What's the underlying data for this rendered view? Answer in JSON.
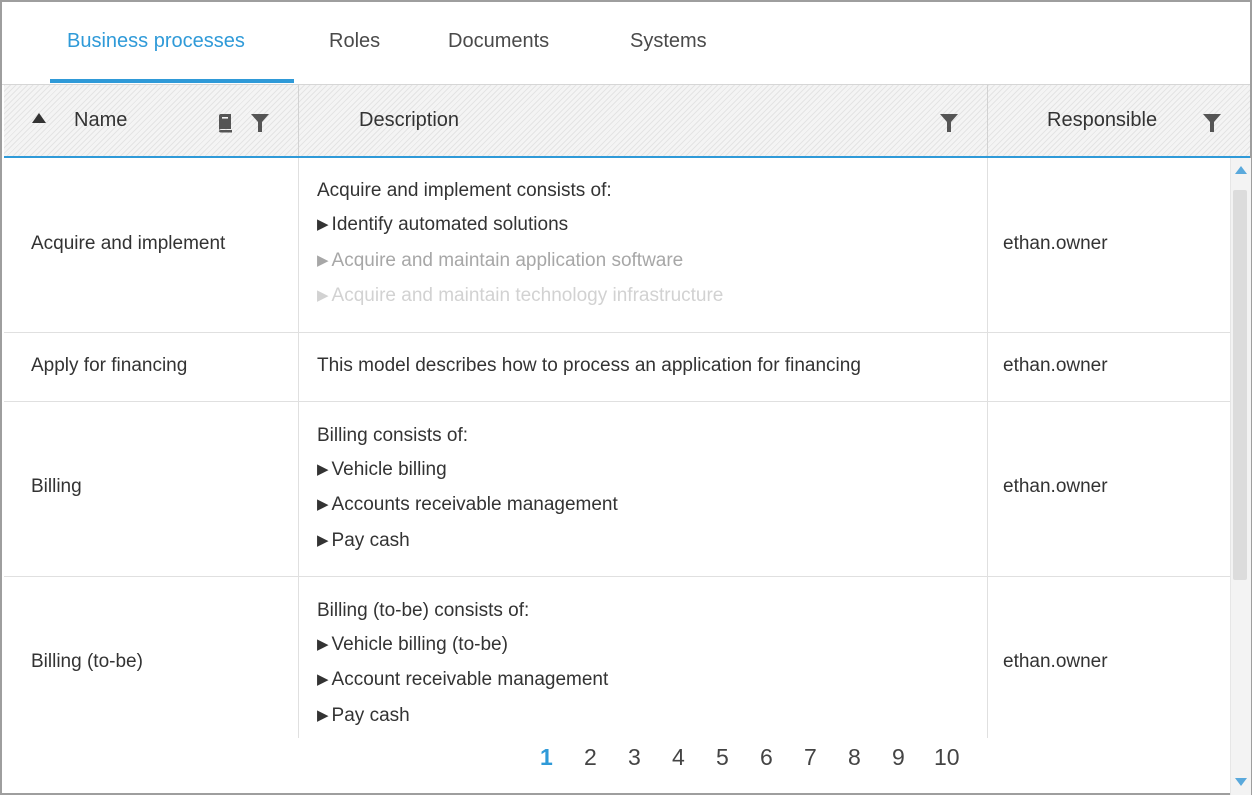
{
  "tabs": [
    {
      "label": "Business processes",
      "active": true
    },
    {
      "label": "Roles"
    },
    {
      "label": "Documents"
    },
    {
      "label": "Systems"
    }
  ],
  "columns": {
    "name": "Name",
    "description": "Description",
    "responsible": "Responsible"
  },
  "icons": {
    "sort": "sort-ascending-icon",
    "book": "book-icon",
    "filter": "filter-icon",
    "scroll_up": "scroll-up-arrow-icon",
    "scroll_down": "scroll-down-arrow-icon"
  },
  "rows": [
    {
      "name": "Acquire and implement",
      "description": {
        "intro": "Acquire and implement consists of:",
        "items": [
          "Identify automated solutions",
          "Acquire and maintain application software",
          "Acquire and maintain technology infrastructure"
        ]
      },
      "responsible": "ethan.owner"
    },
    {
      "name": "Apply for financing",
      "description": {
        "text": "This model describes how to process an application for financing"
      },
      "responsible": "ethan.owner"
    },
    {
      "name": "Billing",
      "description": {
        "intro": "Billing consists of:",
        "items": [
          "Vehicle billing",
          "Accounts receivable management",
          "Pay cash"
        ]
      },
      "responsible": "ethan.owner"
    },
    {
      "name": "Billing (to-be)",
      "description": {
        "intro": "Billing (to-be) consists of:",
        "items": [
          "Vehicle billing (to-be)",
          "Account receivable management",
          "Pay cash"
        ]
      },
      "responsible": "ethan.owner"
    }
  ],
  "pagination": {
    "pages": [
      "1",
      "2",
      "3",
      "4",
      "5",
      "6",
      "7",
      "8",
      "9",
      "10"
    ],
    "current": "1"
  },
  "colors": {
    "accent": "#2f9ad8",
    "text": "#333333",
    "border": "#e0e0e0"
  }
}
